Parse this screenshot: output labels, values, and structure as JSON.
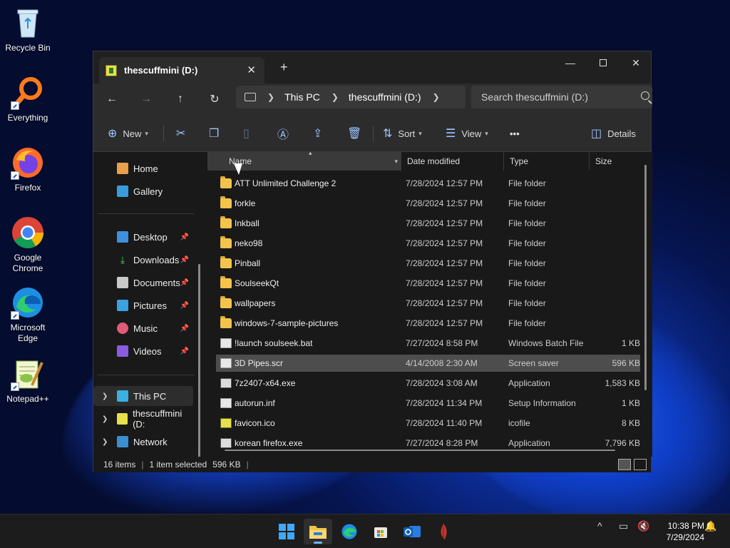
{
  "desktop": {
    "icons": [
      {
        "label": "Recycle Bin"
      },
      {
        "label": "Everything"
      },
      {
        "label": "Firefox"
      },
      {
        "label": "Google Chrome"
      },
      {
        "label": "Microsoft Edge"
      },
      {
        "label": "Notepad++"
      }
    ]
  },
  "window": {
    "tab_title": "thescuffmini (D:)",
    "address": {
      "crumbs": [
        "This PC",
        "thescuffmini (D:)"
      ]
    },
    "search": {
      "placeholder": "Search thescuffmini (D:)"
    },
    "commands": {
      "new": "New",
      "sort": "Sort",
      "view": "View",
      "details": "Details",
      "more": "•••"
    }
  },
  "nav": {
    "items": [
      {
        "label": "Home"
      },
      {
        "label": "Gallery"
      },
      {
        "label": "Desktop"
      },
      {
        "label": "Downloads"
      },
      {
        "label": "Documents"
      },
      {
        "label": "Pictures"
      },
      {
        "label": "Music"
      },
      {
        "label": "Videos"
      },
      {
        "label": "This PC"
      },
      {
        "label": "thescuffmini (D:"
      },
      {
        "label": "Network"
      }
    ]
  },
  "columns": {
    "name": "Name",
    "date": "Date modified",
    "type": "Type",
    "size": "Size"
  },
  "files": [
    {
      "name": "ATT Unlimited Challenge 2",
      "date": "7/28/2024 12:57 PM",
      "type": "File folder",
      "size": ""
    },
    {
      "name": "forkle",
      "date": "7/28/2024 12:57 PM",
      "type": "File folder",
      "size": ""
    },
    {
      "name": "Inkball",
      "date": "7/28/2024 12:57 PM",
      "type": "File folder",
      "size": ""
    },
    {
      "name": "neko98",
      "date": "7/28/2024 12:57 PM",
      "type": "File folder",
      "size": ""
    },
    {
      "name": "Pinball",
      "date": "7/28/2024 12:57 PM",
      "type": "File folder",
      "size": ""
    },
    {
      "name": "SoulseekQt",
      "date": "7/28/2024 12:57 PM",
      "type": "File folder",
      "size": ""
    },
    {
      "name": "wallpapers",
      "date": "7/28/2024 12:57 PM",
      "type": "File folder",
      "size": ""
    },
    {
      "name": "windows-7-sample-pictures",
      "date": "7/28/2024 12:57 PM",
      "type": "File folder",
      "size": ""
    },
    {
      "name": "!launch soulseek.bat",
      "date": "7/27/2024 8:58 PM",
      "type": "Windows Batch File",
      "size": "1 KB"
    },
    {
      "name": "3D Pipes.scr",
      "date": "4/14/2008 2:30 AM",
      "type": "Screen saver",
      "size": "596 KB"
    },
    {
      "name": "7z2407-x64.exe",
      "date": "7/28/2024 3:08 AM",
      "type": "Application",
      "size": "1,583 KB"
    },
    {
      "name": "autorun.inf",
      "date": "7/28/2024 11:34 PM",
      "type": "Setup Information",
      "size": "1 KB"
    },
    {
      "name": "favicon.ico",
      "date": "7/28/2024 11:40 PM",
      "type": "icofile",
      "size": "8 KB"
    },
    {
      "name": "korean firefox.exe",
      "date": "7/27/2024 8:28 PM",
      "type": "Application",
      "size": "7,796 KB"
    }
  ],
  "status": {
    "count": "16 items",
    "selected": "1 item selected",
    "size": "596 KB"
  },
  "taskbar": {
    "time": "10:38 PM",
    "date": "7/29/2024"
  }
}
